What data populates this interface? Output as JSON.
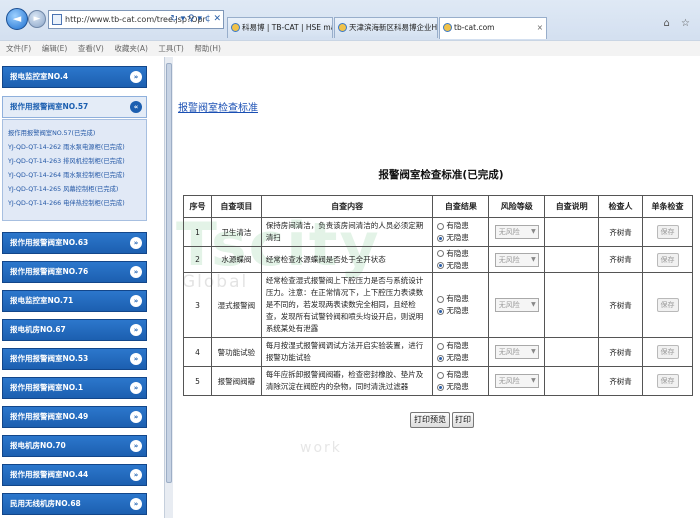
{
  "browser": {
    "url": "http://www.tb-cat.com/tree.jsp?Opr",
    "address_tools": "↻ ▾ ♀ ▾ ¢ ✕",
    "tabs": [
      {
        "label": "科易博 | TB-CAT | HSE mana..."
      },
      {
        "label": "天津滨海新区科易博企业HSE..."
      },
      {
        "label": "tb-cat.com"
      }
    ],
    "menu": [
      "文件(F)",
      "编辑(E)",
      "查看(V)",
      "收藏夹(A)",
      "工具(T)",
      "帮助(H)"
    ],
    "top_right_icons": "⌂ ☆"
  },
  "sidebar": {
    "groups": [
      {
        "label": "报电监控室NO.4"
      },
      {
        "label": "报作用报警阀室NO.57"
      },
      {
        "label": "报作用报警阀室NO.63"
      },
      {
        "label": "报作用报警阀室NO.76"
      },
      {
        "label": "报电监控室NO.71"
      },
      {
        "label": "报电机房NO.67"
      },
      {
        "label": "报作用报警阀室NO.53"
      },
      {
        "label": "报作用报警阀室NO.1"
      },
      {
        "label": "报作用报警阀室NO.49"
      },
      {
        "label": "报电机房NO.70"
      },
      {
        "label": "报作用报警阀室NO.44"
      },
      {
        "label": "民用无线机房NO.68"
      }
    ],
    "sub_items": [
      "报作用报警阀室NO.57(已完成)",
      "YJ-QD-QT-14-262 雨水泵电源柜(已完成)",
      "YJ-QD-QT-14-263 排风机控制柜(已完成)",
      "YJ-QD-QT-14-264 雨水泵控制柜(已完成)",
      "YJ-QD-QT-14-265 风幕控制柜(已完成)",
      "YJ-QD-QT-14-266 电伴热控制柜(已完成)"
    ]
  },
  "main": {
    "link_label": "报警阀室检查标准",
    "title": "报警阀室检查标准(已完成)",
    "columns": [
      "序号",
      "自查项目",
      "自查内容",
      "自查结果",
      "风险等级",
      "自查说明",
      "检查人",
      "单条检查"
    ],
    "radio_labels": {
      "has": "有隐患",
      "none": "无隐患"
    },
    "risk_placeholder": "无风险",
    "save_label": "保存",
    "rows": [
      {
        "no": "1",
        "item": "卫生清洁",
        "content": "保持房间清洁，负责该房间清洁的人员必须定期清扫",
        "checker": "齐树青"
      },
      {
        "no": "2",
        "item": "水源蝶阀",
        "content": "经常检查水源蝶阀是否处于全开状态",
        "checker": "齐树青"
      },
      {
        "no": "3",
        "item": "湿式报警阀",
        "content": "经常检查湿式报警阀上下腔压力是否与系统设计压力。注意：在正常情况下，上下腔压力表读数是不同的，若发现两表读数完全相同，且经检查，发现所有试警铃阀和喷头均设开启，则说明系统某处有泄露",
        "checker": "齐树青"
      },
      {
        "no": "4",
        "item": "警功能试验",
        "content": "每月按湿式报警阀调试方法开启实验装置，进行报警功能试验",
        "checker": "齐树青"
      },
      {
        "no": "5",
        "item": "报警阀阀瓣",
        "content": "每年应拆卸报警阀阀瓣，检查密封橡胶、垫片及清除沉淀在阀腔内的杂物，同时清洗过滤器",
        "checker": "齐树青"
      }
    ],
    "print_preview_label": "打印预览",
    "print_label": "打印"
  },
  "watermark": {
    "big": "Tscity",
    "mid": "Global",
    "small": "work"
  }
}
